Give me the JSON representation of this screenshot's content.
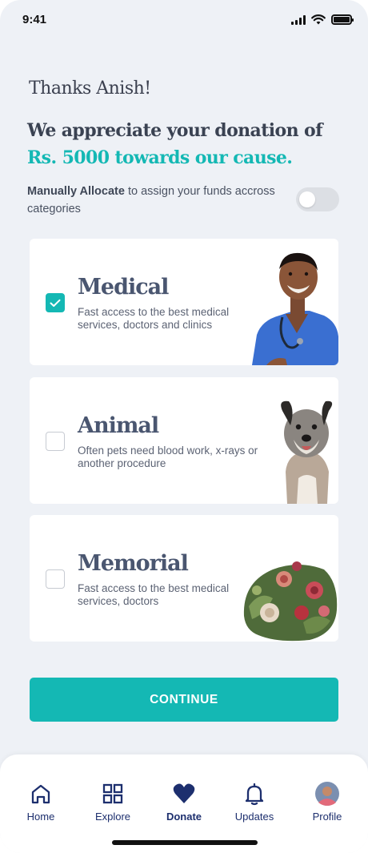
{
  "status_bar": {
    "time": "9:41"
  },
  "greeting": "Thanks Anish!",
  "headline": {
    "line1": "We appreciate your donation of",
    "line2": "Rs. 5000 towards our cause."
  },
  "allocate": {
    "bold": "Manually Allocate",
    "rest": " to assign your funds accross categories",
    "toggle_on": false
  },
  "categories": [
    {
      "title": "Medical",
      "description": "Fast access to the best medical services, doctors and clinics",
      "checked": true,
      "image": "doctor-photo"
    },
    {
      "title": "Animal",
      "description": "Often pets need blood work, x-rays or another procedure",
      "checked": false,
      "image": "dog-photo"
    },
    {
      "title": "Memorial",
      "description": "Fast access to the best medical services, doctors",
      "checked": false,
      "image": "flowers-photo"
    }
  ],
  "continue_label": "CONTINUE",
  "nav": [
    {
      "label": "Home",
      "icon": "home-icon"
    },
    {
      "label": "Explore",
      "icon": "grid-icon"
    },
    {
      "label": "Donate",
      "icon": "heart-icon",
      "active": true
    },
    {
      "label": "Updates",
      "icon": "bell-icon"
    },
    {
      "label": "Profile",
      "icon": "avatar"
    }
  ],
  "colors": {
    "accent": "#14b8b4",
    "nav": "#1d2f6e",
    "background": "#eef1f6"
  }
}
